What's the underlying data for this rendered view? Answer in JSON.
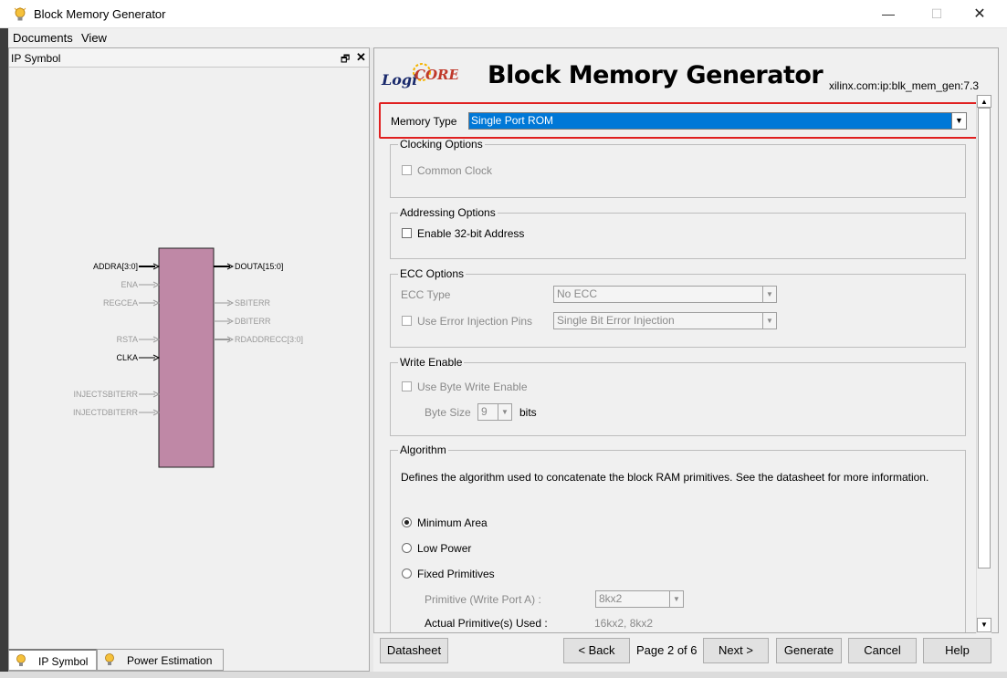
{
  "window": {
    "title": "Block Memory Generator",
    "buttons": {
      "minimize": "—",
      "maximize": "☐",
      "close": "✕"
    }
  },
  "menu": {
    "documents": "Documents",
    "view": "View"
  },
  "left_panel": {
    "title": "IP Symbol",
    "float_glyph": "🗗",
    "close_glyph": "✕",
    "symbol": {
      "left_ports": [
        {
          "name": "ADDRA[3:0]",
          "active": true,
          "bus": true
        },
        {
          "name": "ENA",
          "active": false,
          "bus": false
        },
        {
          "name": "REGCEA",
          "active": false,
          "bus": false
        },
        {
          "name": "RSTA",
          "active": false,
          "bus": false
        },
        {
          "name": "CLKA",
          "active": true,
          "bus": false
        },
        {
          "name": "INJECTSBITERR",
          "active": false,
          "bus": false
        },
        {
          "name": "INJECTDBITERR",
          "active": false,
          "bus": false
        }
      ],
      "right_ports": [
        {
          "name": "DOUTA[15:0]",
          "active": true,
          "bus": true
        },
        {
          "name": "SBITERR",
          "active": false,
          "bus": false
        },
        {
          "name": "DBITERR",
          "active": false,
          "bus": false
        },
        {
          "name": "RDADDRECC[3:0]",
          "active": false,
          "bus": true
        }
      ],
      "block_color": "#bf88a6"
    },
    "tabs": [
      {
        "label": "IP Symbol",
        "active": true
      },
      {
        "label": "Power Estimation",
        "active": false
      }
    ]
  },
  "header": {
    "logo_text": "LogiCORE",
    "title": "Block Memory Generator",
    "ip_id": "xilinx.com:ip:blk_mem_gen:7.3"
  },
  "memory_type": {
    "label": "Memory Type",
    "value": "Single Port ROM"
  },
  "clocking": {
    "legend": "Clocking Options",
    "common_clock": "Common Clock"
  },
  "addressing": {
    "legend": "Addressing Options",
    "enable_32bit": "Enable 32-bit Address"
  },
  "ecc": {
    "legend": "ECC Options",
    "type_label": "ECC Type",
    "type_value": "No ECC",
    "injection_label": "Use Error Injection Pins",
    "injection_value": "Single Bit Error Injection"
  },
  "write_enable": {
    "legend": "Write Enable",
    "byte_write": "Use Byte Write Enable",
    "byte_size_label": "Byte Size",
    "byte_size_value": "9",
    "bits": "bits"
  },
  "algorithm": {
    "legend": "Algorithm",
    "description": "Defines the algorithm used to concatenate the block RAM primitives.  See the datasheet for more information.",
    "options": [
      "Minimum Area",
      "Low Power",
      "Fixed Primitives"
    ],
    "selected": "Minimum Area",
    "primitive_label": "Primitive (Write Port A) :",
    "primitive_value": "8kx2",
    "actual_label": "Actual Primitive(s) Used :",
    "actual_value": "16kx2, 8kx2"
  },
  "buttons": {
    "datasheet": "Datasheet",
    "back": "< Back",
    "page": "Page 2 of 6",
    "next": "Next >",
    "generate": "Generate",
    "cancel": "Cancel",
    "help": "Help"
  },
  "colors": {
    "accent": "#0078d7",
    "highlight": "#e02020",
    "block": "#bf88a6"
  }
}
